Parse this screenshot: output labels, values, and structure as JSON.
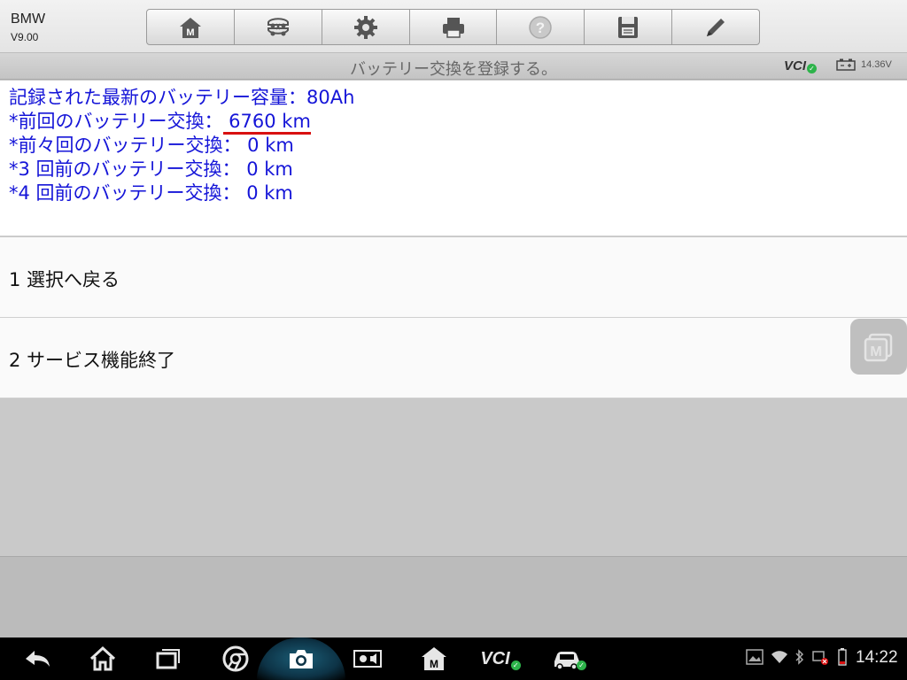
{
  "app": {
    "title": "BMW",
    "version": "V9.00"
  },
  "toolbar": {
    "buttons": [
      {
        "icon": "home-m-icon"
      },
      {
        "icon": "vehicle-swap-icon"
      },
      {
        "icon": "settings-gear-icon"
      },
      {
        "icon": "printer-icon"
      },
      {
        "icon": "help-icon"
      },
      {
        "icon": "save-floppy-icon"
      },
      {
        "icon": "edit-pencil-icon"
      }
    ]
  },
  "titlebar": {
    "title": "バッテリー交換を登録する。",
    "vci_label": "VCI",
    "battery_voltage": "14.36V"
  },
  "info": {
    "line1": "記録された最新のバッテリー容量：80Ah",
    "line2_prefix": "*前回のバッテリー交換：",
    "line2_value": " 6760 km",
    "line3": "*前々回のバッテリー交換： 0 km",
    "line4": "*3 回前のバッテリー交換： 0 km",
    "line5": "*4 回前のバッテリー交換： 0 km"
  },
  "menu": {
    "items": [
      {
        "label": "1 選択へ戻る"
      },
      {
        "label": "2 サービス機能終了"
      }
    ]
  },
  "floating_button": {
    "icon": "m-logo-icon"
  },
  "navbar": {
    "vci_label": "VCI",
    "clock": "14:22"
  },
  "colors": {
    "info_text": "#1515d8",
    "underline": "#d81010",
    "check_green": "#2db34a"
  }
}
